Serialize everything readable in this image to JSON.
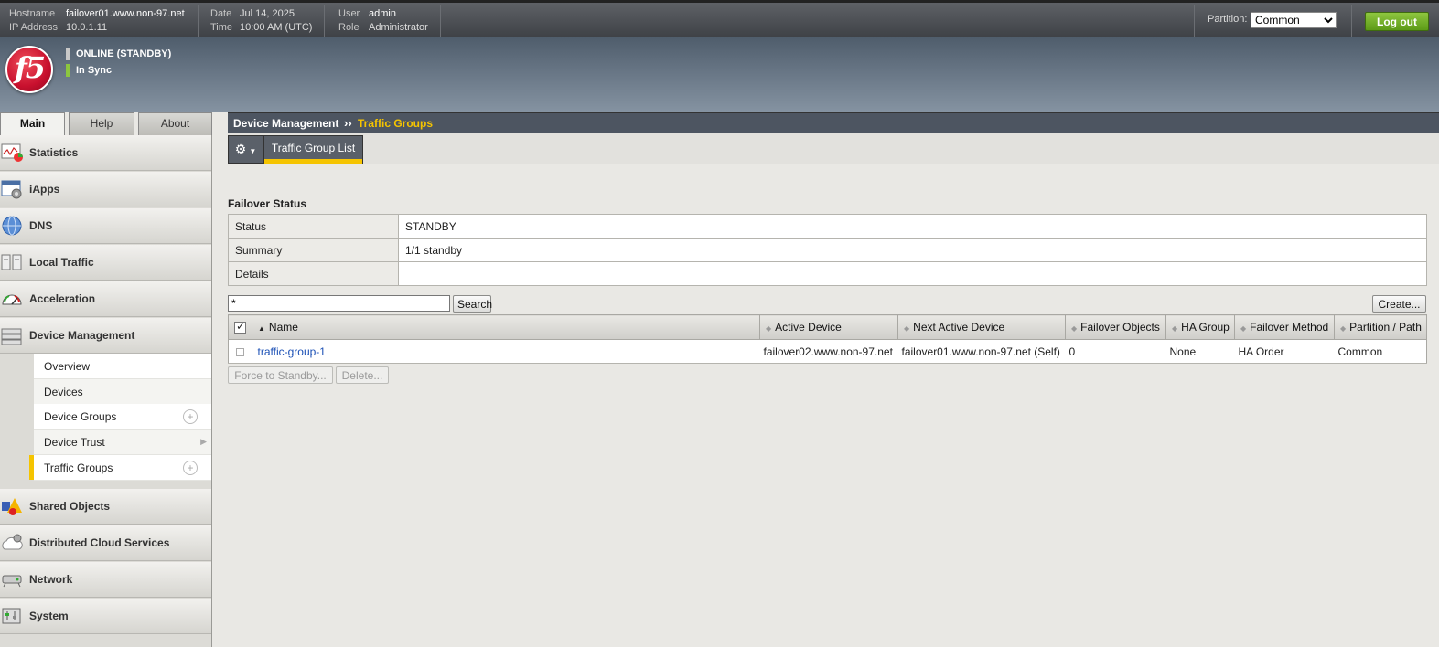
{
  "header": {
    "hostname_label": "Hostname",
    "hostname": "failover01.www.non-97.net",
    "ip_label": "IP Address",
    "ip": "10.0.1.11",
    "date_label": "Date",
    "date": "Jul 14, 2025",
    "time_label": "Time",
    "time": "10:00 AM (UTC)",
    "user_label": "User",
    "user": "admin",
    "role_label": "Role",
    "role": "Administrator",
    "partition_label": "Partition:",
    "partition_value": "Common",
    "logout_label": "Log out"
  },
  "banner": {
    "logo_text": "f5",
    "status_online": "ONLINE (STANDBY)",
    "status_online_color": "#c8c8c8",
    "status_sync": "In Sync",
    "status_sync_color": "#8cc63f"
  },
  "tabs": [
    "Main",
    "Help",
    "About"
  ],
  "sidebar": {
    "items": [
      {
        "label": "Statistics",
        "icon": "statistics-icon"
      },
      {
        "label": "iApps",
        "icon": "iapps-icon"
      },
      {
        "label": "DNS",
        "icon": "dns-globe-icon"
      },
      {
        "label": "Local Traffic",
        "icon": "local-traffic-icon"
      },
      {
        "label": "Acceleration",
        "icon": "acceleration-gauge-icon"
      },
      {
        "label": "Device Management",
        "icon": "device-management-icon"
      },
      {
        "label": "Shared Objects",
        "icon": "shared-objects-icon"
      },
      {
        "label": "Distributed Cloud Services",
        "icon": "cloud-gear-icon"
      },
      {
        "label": "Network",
        "icon": "network-icon"
      },
      {
        "label": "System",
        "icon": "system-icon"
      }
    ],
    "subitems": [
      {
        "label": "Overview"
      },
      {
        "label": "Devices"
      },
      {
        "label": "Device Groups"
      },
      {
        "label": "Device Trust"
      },
      {
        "label": "Traffic Groups"
      }
    ]
  },
  "breadcrumb": {
    "section": "Device Management",
    "separator": "››",
    "page": "Traffic Groups"
  },
  "subtab": {
    "label": "Traffic Group List"
  },
  "failover_status": {
    "title": "Failover Status",
    "rows": [
      {
        "key": "Status",
        "value": "STANDBY"
      },
      {
        "key": "Summary",
        "value": "1/1 standby"
      },
      {
        "key": "Details",
        "value": ""
      }
    ]
  },
  "search": {
    "value": "*",
    "button": "Search"
  },
  "create_button": "Create...",
  "table": {
    "columns": [
      "Name",
      "Active Device",
      "Next Active Device",
      "Failover Objects",
      "HA Group",
      "Failover Method",
      "Partition / Path"
    ],
    "rows": [
      {
        "name": "traffic-group-1",
        "active_device": "failover02.www.non-97.net",
        "next_active_device": "failover01.www.non-97.net (Self)",
        "failover_objects": "0",
        "ha_group": "None",
        "failover_method": "HA Order",
        "partition": "Common"
      }
    ]
  },
  "actions": {
    "force_standby": "Force to Standby...",
    "delete": "Delete..."
  }
}
